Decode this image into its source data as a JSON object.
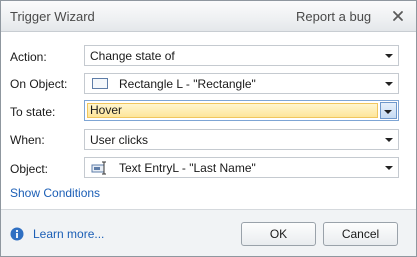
{
  "window": {
    "title": "Trigger Wizard",
    "report_link": "Report a bug",
    "close_icon": "close-icon"
  },
  "form": {
    "action": {
      "label": "Action:",
      "value": "Change state of"
    },
    "on_object": {
      "label": "On Object:",
      "value": "Rectangle L - \"Rectangle\"",
      "icon": "rectangle-icon"
    },
    "to_state": {
      "label": "To state:",
      "value": "Hover"
    },
    "when": {
      "label": "When:",
      "value": "User clicks"
    },
    "object": {
      "label": "Object:",
      "value": "Text EntryL - \"Last Name\"",
      "icon": "text-entry-icon"
    }
  },
  "show_conditions": "Show Conditions",
  "footer": {
    "learn_more": "Learn more...",
    "ok_label": "OK",
    "cancel_label": "Cancel"
  },
  "colors": {
    "highlight": "#fde59a",
    "link": "#1c5fb6",
    "accent": "#6e98cb"
  }
}
